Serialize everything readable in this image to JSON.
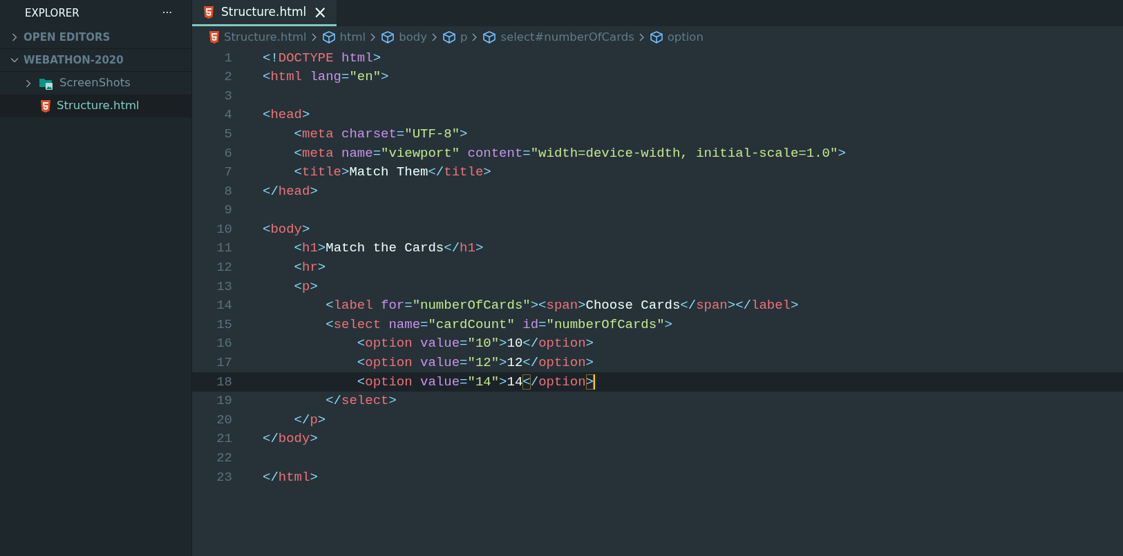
{
  "sidebar": {
    "title": "EXPLORER",
    "more": "···",
    "sections": [
      {
        "label": "OPEN EDITORS",
        "expanded": false
      },
      {
        "label": "WEBATHON-2020",
        "expanded": true
      }
    ],
    "items": [
      {
        "label": "ScreenShots",
        "kind": "folder",
        "expanded": false,
        "selected": false
      },
      {
        "label": "Structure.html",
        "kind": "html",
        "selected": true
      }
    ]
  },
  "tabs": [
    {
      "label": "Structure.html",
      "close": "×",
      "selected": true
    }
  ],
  "breadcrumb": [
    {
      "label": "Structure.html",
      "kind": "html"
    },
    {
      "label": "html",
      "kind": "element"
    },
    {
      "label": "body",
      "kind": "element"
    },
    {
      "label": "p",
      "kind": "element"
    },
    {
      "label": "select#numberOfCards",
      "kind": "element"
    },
    {
      "label": "option",
      "kind": "element"
    }
  ],
  "lines": [
    {
      "number": "1",
      "current": false,
      "tokens": [
        {
          "kind": "punct",
          "text": "<!"
        },
        {
          "kind": "tag",
          "text": "DOCTYPE"
        },
        {
          "kind": "attr",
          "text": " html"
        },
        {
          "kind": "punct",
          "text": ">"
        }
      ]
    },
    {
      "number": "2",
      "current": false,
      "tokens": [
        {
          "kind": "punct",
          "text": "<"
        },
        {
          "kind": "tag",
          "text": "html"
        },
        {
          "kind": "attr",
          "text": " lang"
        },
        {
          "kind": "punct",
          "text": "="
        },
        {
          "kind": "string",
          "text": "\"en\""
        },
        {
          "kind": "punct",
          "text": ">"
        }
      ]
    },
    {
      "number": "3",
      "current": false
    },
    {
      "number": "4",
      "current": false,
      "tokens": [
        {
          "kind": "punct",
          "text": "<"
        },
        {
          "kind": "tag",
          "text": "head"
        },
        {
          "kind": "punct",
          "text": ">"
        }
      ]
    },
    {
      "number": "5",
      "current": false,
      "tokens": [
        {
          "kind": "punct",
          "text": "    <"
        },
        {
          "kind": "tag",
          "text": "meta"
        },
        {
          "kind": "attr",
          "text": " charset"
        },
        {
          "kind": "punct",
          "text": "="
        },
        {
          "kind": "string",
          "text": "\"UTF-8\""
        },
        {
          "kind": "punct",
          "text": ">"
        }
      ]
    },
    {
      "number": "6",
      "current": false,
      "tokens": [
        {
          "kind": "punct",
          "text": "    <"
        },
        {
          "kind": "tag",
          "text": "meta"
        },
        {
          "kind": "attr",
          "text": " name"
        },
        {
          "kind": "punct",
          "text": "="
        },
        {
          "kind": "string",
          "text": "\"viewport\""
        },
        {
          "kind": "attr",
          "text": " content"
        },
        {
          "kind": "punct",
          "text": "="
        },
        {
          "kind": "string",
          "text": "\"width=device-width, initial-scale=1.0\""
        },
        {
          "kind": "punct",
          "text": ">"
        }
      ]
    },
    {
      "number": "7",
      "current": false,
      "tokens": [
        {
          "kind": "punct",
          "text": "    <"
        },
        {
          "kind": "tag",
          "text": "title"
        },
        {
          "kind": "punct",
          "text": ">"
        },
        {
          "kind": "text",
          "text": "Match Them"
        },
        {
          "kind": "punct",
          "text": "</"
        },
        {
          "kind": "tag",
          "text": "title"
        },
        {
          "kind": "punct",
          "text": ">"
        }
      ]
    },
    {
      "number": "8",
      "current": false,
      "tokens": [
        {
          "kind": "punct",
          "text": "</"
        },
        {
          "kind": "tag",
          "text": "head"
        },
        {
          "kind": "punct",
          "text": ">"
        }
      ]
    },
    {
      "number": "9",
      "current": false
    },
    {
      "number": "10",
      "current": false,
      "tokens": [
        {
          "kind": "punct",
          "text": "<"
        },
        {
          "kind": "tag",
          "text": "body"
        },
        {
          "kind": "punct",
          "text": ">"
        }
      ]
    },
    {
      "number": "11",
      "current": false,
      "tokens": [
        {
          "kind": "punct",
          "text": "    <"
        },
        {
          "kind": "tag",
          "text": "h1"
        },
        {
          "kind": "punct",
          "text": ">"
        },
        {
          "kind": "text",
          "text": "Match the Cards"
        },
        {
          "kind": "punct",
          "text": "</"
        },
        {
          "kind": "tag",
          "text": "h1"
        },
        {
          "kind": "punct",
          "text": ">"
        }
      ]
    },
    {
      "number": "12",
      "current": false,
      "tokens": [
        {
          "kind": "punct",
          "text": "    <"
        },
        {
          "kind": "tag",
          "text": "hr"
        },
        {
          "kind": "punct",
          "text": ">"
        }
      ]
    },
    {
      "number": "13",
      "current": false,
      "tokens": [
        {
          "kind": "punct",
          "text": "    <"
        },
        {
          "kind": "tag",
          "text": "p"
        },
        {
          "kind": "punct",
          "text": ">"
        }
      ]
    },
    {
      "number": "14",
      "current": false,
      "tokens": [
        {
          "kind": "punct",
          "text": "        <"
        },
        {
          "kind": "tag",
          "text": "label"
        },
        {
          "kind": "attr",
          "text": " for"
        },
        {
          "kind": "punct",
          "text": "="
        },
        {
          "kind": "string",
          "text": "\"numberOfCards\""
        },
        {
          "kind": "punct",
          "text": "><"
        },
        {
          "kind": "tag",
          "text": "span"
        },
        {
          "kind": "punct",
          "text": ">"
        },
        {
          "kind": "text",
          "text": "Choose Cards"
        },
        {
          "kind": "punct",
          "text": "</"
        },
        {
          "kind": "tag",
          "text": "span"
        },
        {
          "kind": "punct",
          "text": "></"
        },
        {
          "kind": "tag",
          "text": "label"
        },
        {
          "kind": "punct",
          "text": ">"
        }
      ]
    },
    {
      "number": "15",
      "current": false,
      "tokens": [
        {
          "kind": "punct",
          "text": "        <"
        },
        {
          "kind": "tag",
          "text": "select"
        },
        {
          "kind": "attr",
          "text": " name"
        },
        {
          "kind": "punct",
          "text": "="
        },
        {
          "kind": "string",
          "text": "\"cardCount\""
        },
        {
          "kind": "attr",
          "text": " id"
        },
        {
          "kind": "punct",
          "text": "="
        },
        {
          "kind": "string",
          "text": "\"numberOfCards\""
        },
        {
          "kind": "punct",
          "text": ">"
        }
      ]
    },
    {
      "number": "16",
      "current": false,
      "tokens": [
        {
          "kind": "punct",
          "text": "            <"
        },
        {
          "kind": "tag",
          "text": "option"
        },
        {
          "kind": "attr",
          "text": " value"
        },
        {
          "kind": "punct",
          "text": "="
        },
        {
          "kind": "string",
          "text": "\"10\""
        },
        {
          "kind": "punct",
          "text": ">"
        },
        {
          "kind": "text",
          "text": "10"
        },
        {
          "kind": "punct",
          "text": "</"
        },
        {
          "kind": "tag",
          "text": "option"
        },
        {
          "kind": "punct",
          "text": ">"
        }
      ]
    },
    {
      "number": "17",
      "current": false,
      "tokens": [
        {
          "kind": "punct",
          "text": "            <"
        },
        {
          "kind": "tag",
          "text": "option"
        },
        {
          "kind": "attr",
          "text": " value"
        },
        {
          "kind": "punct",
          "text": "="
        },
        {
          "kind": "string",
          "text": "\"12\""
        },
        {
          "kind": "punct",
          "text": ">"
        },
        {
          "kind": "text",
          "text": "12"
        },
        {
          "kind": "punct",
          "text": "</"
        },
        {
          "kind": "tag",
          "text": "option"
        },
        {
          "kind": "punct",
          "text": ">"
        }
      ]
    },
    {
      "number": "18",
      "current": true,
      "tokens": [
        {
          "kind": "punct",
          "text": "            <"
        },
        {
          "kind": "tag",
          "text": "option"
        },
        {
          "kind": "attr",
          "text": " value"
        },
        {
          "kind": "punct",
          "text": "="
        },
        {
          "kind": "string",
          "text": "\"14\""
        },
        {
          "kind": "punct",
          "text": ">"
        },
        {
          "kind": "text",
          "text": "14"
        },
        {
          "kind": "match",
          "text": "<"
        },
        {
          "kind": "punct",
          "text": "/"
        },
        {
          "kind": "tag",
          "text": "option"
        },
        {
          "kind": "match",
          "text": ">"
        }
      ]
    },
    {
      "number": "19",
      "current": false,
      "tokens": [
        {
          "kind": "punct",
          "text": "        </"
        },
        {
          "kind": "tag",
          "text": "select"
        },
        {
          "kind": "punct",
          "text": ">"
        }
      ]
    },
    {
      "number": "20",
      "current": false,
      "tokens": [
        {
          "kind": "punct",
          "text": "    </"
        },
        {
          "kind": "tag",
          "text": "p"
        },
        {
          "kind": "punct",
          "text": ">"
        }
      ]
    },
    {
      "number": "21",
      "current": false,
      "tokens": [
        {
          "kind": "punct",
          "text": "</"
        },
        {
          "kind": "tag",
          "text": "body"
        },
        {
          "kind": "punct",
          "text": ">"
        }
      ]
    },
    {
      "number": "22",
      "current": false
    },
    {
      "number": "23",
      "current": false,
      "tokens": [
        {
          "kind": "punct",
          "text": "</"
        },
        {
          "kind": "tag",
          "text": "html"
        },
        {
          "kind": "punct",
          "text": ">"
        }
      ]
    }
  ]
}
